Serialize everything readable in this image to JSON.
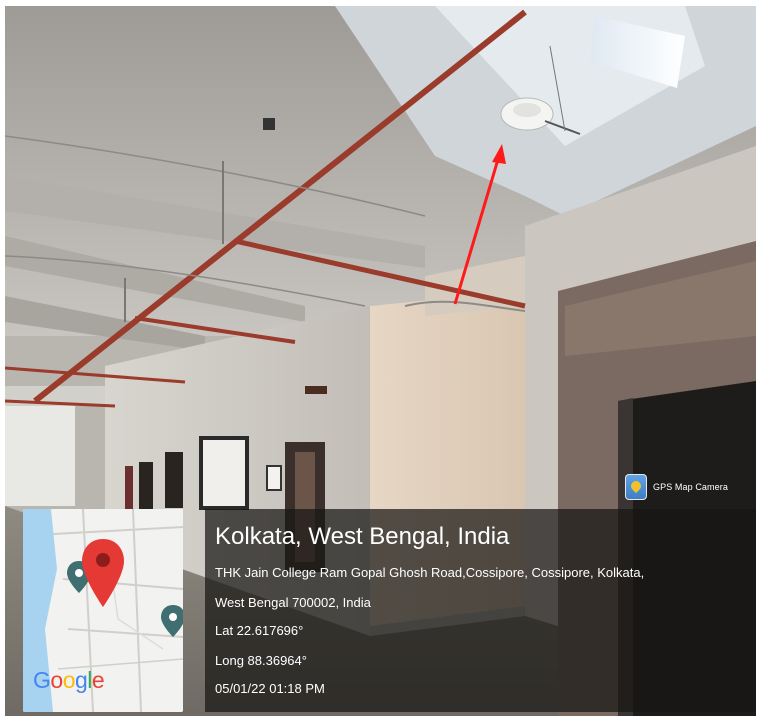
{
  "watermark": {
    "app_name": "GPS Map Camera",
    "logo_icon": "gps-map-camera-icon"
  },
  "map_thumbnail": {
    "logo_text": [
      "G",
      "o",
      "o",
      "g",
      "l",
      "e"
    ],
    "logo_colors": [
      "#4285F4",
      "#EA4335",
      "#FBBC05",
      "#4285F4",
      "#34A853",
      "#EA4335"
    ],
    "pin_color": "#e53935",
    "secondary_pin_color": "#3f6f70"
  },
  "location": {
    "title": "Kolkata, West Bengal, India",
    "address_line1": "THK Jain College Ram Gopal Ghosh Road,Cossipore, Cossipore, Kolkata,",
    "address_line2": "West Bengal 700002, India",
    "lat": "Lat 22.617696°",
    "long": "Long 88.36964°",
    "datetime": "05/01/22 01:18 PM"
  },
  "annotation": {
    "arrow_color": "#ff1a1a"
  }
}
